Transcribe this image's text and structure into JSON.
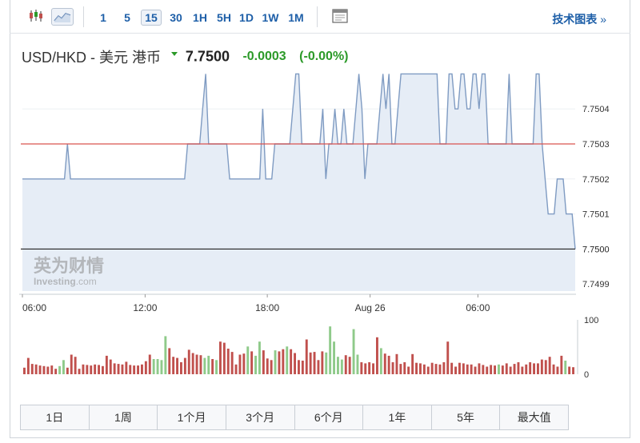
{
  "toolbar": {
    "timeframes": [
      "1",
      "5",
      "15",
      "30",
      "1H",
      "5H",
      "1D",
      "1W",
      "1M"
    ],
    "active_timeframe": "15",
    "tech_chart_label": "技术图表",
    "tech_chart_arrow": "»"
  },
  "quote": {
    "name": "USD/HKD - 美元 港币",
    "price": "7.7500",
    "change": "-0.0003",
    "change_pct": "(-0.00%)",
    "change_color": "#2c9a29"
  },
  "watermark": {
    "cn": "英为财情",
    "en_bold": "Investing",
    "en_suffix": ".com"
  },
  "periods": [
    "1日",
    "1周",
    "1个月",
    "3个月",
    "6个月",
    "1年",
    "5年",
    "最大值"
  ],
  "chart_data": [
    {
      "type": "area",
      "colors": {
        "line": "#7f9bc2",
        "fill": "#e6edf6",
        "reference_line": "#d9534f",
        "last_price_line": "#222222"
      },
      "x_ticks": [
        "06:00",
        "12:00",
        "18:00",
        "Aug 26",
        "06:00"
      ],
      "y_ticks": [
        "7.7499",
        "7.7500",
        "7.7501",
        "7.7502",
        "7.7503",
        "7.7504"
      ],
      "ylim": [
        7.74988,
        7.75051
      ],
      "reference_value": 7.7503,
      "last_value": 7.75,
      "last_value_label": "7.7500",
      "grid": "horizontal",
      "values": [
        7.7502,
        7.7502,
        7.7502,
        7.7502,
        7.7502,
        7.7502,
        7.7502,
        7.7502,
        7.7502,
        7.7502,
        7.7502,
        7.7502,
        7.7502,
        7.7502,
        7.7502,
        7.7503,
        7.7502,
        7.7502,
        7.7502,
        7.7502,
        7.7502,
        7.7502,
        7.7502,
        7.7502,
        7.7502,
        7.7502,
        7.7502,
        7.7502,
        7.7502,
        7.7502,
        7.7502,
        7.7502,
        7.7502,
        7.7502,
        7.7502,
        7.7502,
        7.7502,
        7.7502,
        7.7502,
        7.7502,
        7.7502,
        7.7502,
        7.7502,
        7.7502,
        7.7502,
        7.7502,
        7.7502,
        7.7502,
        7.7502,
        7.7502,
        7.7502,
        7.7502,
        7.7502,
        7.7502,
        7.7502,
        7.7503,
        7.7503,
        7.7503,
        7.7503,
        7.7503,
        7.7504,
        7.7505,
        7.7503,
        7.7503,
        7.7503,
        7.7503,
        7.7503,
        7.7503,
        7.7503,
        7.7502,
        7.7502,
        7.7502,
        7.7502,
        7.7502,
        7.7502,
        7.7502,
        7.7502,
        7.7502,
        7.7502,
        7.7502,
        7.7504,
        7.7502,
        7.7502,
        7.7502,
        7.7503,
        7.7503,
        7.7503,
        7.7503,
        7.7503,
        7.7503,
        7.7504,
        7.7505,
        7.7505,
        7.7503,
        7.7503,
        7.7503,
        7.7503,
        7.7503,
        7.7503,
        7.7503,
        7.7504,
        7.7502,
        7.7503,
        7.7503,
        7.7504,
        7.7503,
        7.7503,
        7.7504,
        7.7503,
        7.7503,
        7.7503,
        7.7504,
        7.7505,
        7.7504,
        7.7502,
        7.7503,
        7.7503,
        7.7503,
        7.7503,
        7.7504,
        7.7505,
        7.7504,
        7.7505,
        7.7503,
        7.7503,
        7.7504,
        7.7505,
        7.7505,
        7.7505,
        7.7505,
        7.7505,
        7.7505,
        7.7505,
        7.7505,
        7.7505,
        7.7505,
        7.7505,
        7.7505,
        7.7505,
        7.7503,
        7.7503,
        7.7503,
        7.7505,
        7.7505,
        7.7504,
        7.7504,
        7.7505,
        7.7505,
        7.7504,
        7.7504,
        7.7505,
        7.7505,
        7.7504,
        7.7505,
        7.7505,
        7.7503,
        7.7503,
        7.7503,
        7.7503,
        7.7503,
        7.7503,
        7.7503,
        7.7505,
        7.7503,
        7.7503,
        7.7503,
        7.7503,
        7.7503,
        7.7503,
        7.7503,
        7.7503,
        7.7505,
        7.7505,
        7.7503,
        7.7502,
        7.7501,
        7.7501,
        7.7501,
        7.7502,
        7.7502,
        7.7502,
        7.7501,
        7.7501,
        7.7501,
        7.75
      ]
    },
    {
      "type": "bar",
      "name": "volume",
      "y_ticks": [
        "0",
        "100"
      ],
      "ylim": [
        0,
        100
      ],
      "colors": {
        "down": "#c0504d",
        "up": "#8fca8a"
      },
      "values": [
        12,
        30,
        19,
        18,
        16,
        15,
        14,
        16,
        10,
        15,
        26,
        12,
        36,
        32,
        10,
        18,
        17,
        16,
        18,
        17,
        15,
        34,
        27,
        20,
        19,
        18,
        23,
        17,
        16,
        16,
        18,
        24,
        36,
        28,
        28,
        26,
        70,
        48,
        32,
        30,
        22,
        30,
        45,
        39,
        36,
        35,
        30,
        34,
        28,
        26,
        60,
        58,
        47,
        41,
        18,
        36,
        38,
        51,
        42,
        34,
        60,
        44,
        29,
        26,
        44,
        42,
        46,
        51,
        46,
        39,
        26,
        25,
        64,
        40,
        41,
        26,
        42,
        40,
        88,
        60,
        32,
        27,
        35,
        32,
        83,
        36,
        22,
        20,
        22,
        20,
        68,
        48,
        38,
        34,
        22,
        37,
        19,
        22,
        14,
        37,
        21,
        20,
        18,
        14,
        21,
        19,
        18,
        22,
        60,
        21,
        14,
        21,
        20,
        18,
        18,
        14,
        20,
        17,
        14,
        17,
        16,
        18,
        16,
        20,
        14,
        19,
        22,
        14,
        18,
        22,
        20,
        20,
        27,
        26,
        32,
        18,
        14,
        34,
        25,
        14,
        13
      ],
      "up_bars": [
        9,
        10,
        33,
        34,
        35,
        36,
        46,
        47,
        49,
        57,
        59,
        60,
        64,
        67,
        77,
        78,
        79,
        80,
        81,
        84,
        85,
        91,
        121,
        138
      ]
    }
  ]
}
